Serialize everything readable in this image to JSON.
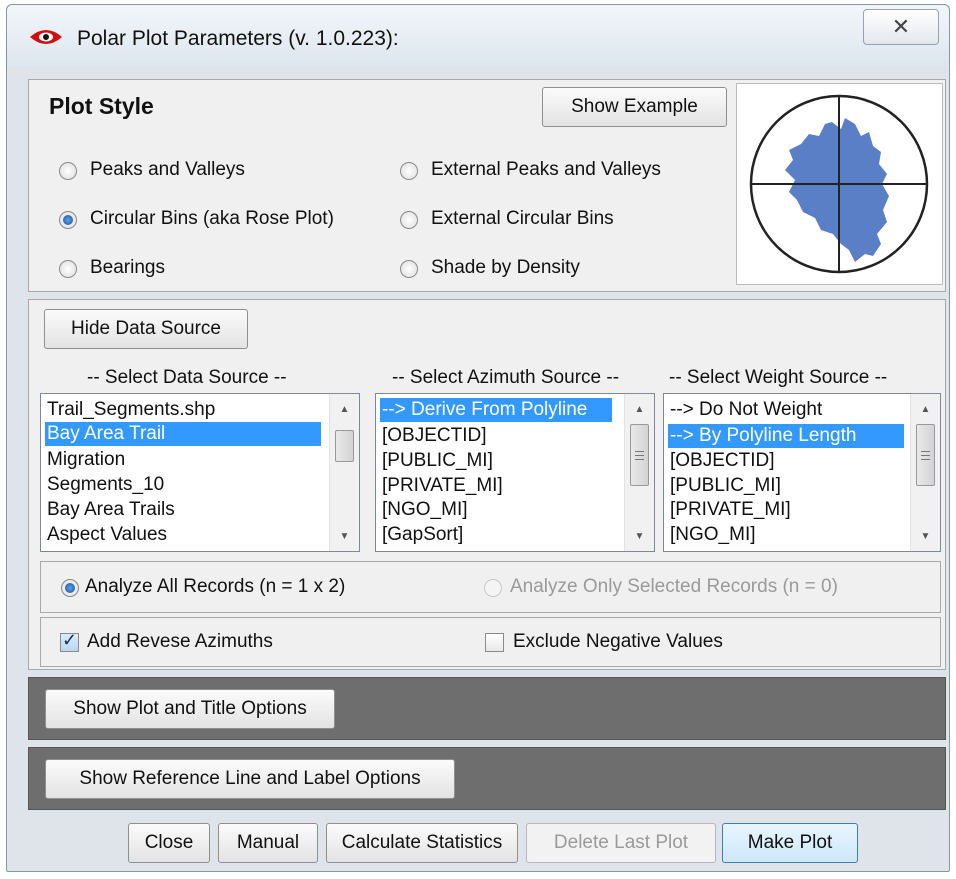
{
  "window": {
    "title": "Polar Plot Parameters (v. 1.0.223):",
    "close_glyph": "✕"
  },
  "plot_style": {
    "heading": "Plot Style",
    "show_example_label": "Show Example",
    "options": [
      {
        "label": "Peaks and Valleys",
        "checked": false
      },
      {
        "label": "External Peaks and Valleys",
        "checked": false
      },
      {
        "label": "Circular Bins (aka Rose Plot)",
        "checked": true
      },
      {
        "label": "External Circular Bins",
        "checked": false
      },
      {
        "label": "Bearings",
        "checked": false
      },
      {
        "label": "Shade by Density",
        "checked": false
      }
    ],
    "preview_icon": "rose-plot-preview",
    "preview_fill": "#5b7fc6"
  },
  "data_source": {
    "hide_button_label": "Hide Data Source",
    "data_list": {
      "caption": "-- Select Data Source --",
      "items": [
        "Trail_Segments.shp",
        "Bay Area Trail",
        "Migration",
        "Segments_10",
        "Bay Area Trails",
        "Aspect Values"
      ],
      "selected": "Bay Area Trail"
    },
    "azimuth_list": {
      "caption": "-- Select Azimuth Source --",
      "items": [
        "--> Derive From Polyline",
        "[OBJECTID]",
        "[PUBLIC_MI]",
        "[PRIVATE_MI]",
        "[NGO_MI]",
        "[GapSort]"
      ],
      "selected": "--> Derive From Polyline"
    },
    "weight_list": {
      "caption": "-- Select Weight Source --",
      "items": [
        "--> Do Not Weight",
        "--> By Polyline Length",
        "[OBJECTID]",
        "[PUBLIC_MI]",
        "[PRIVATE_MI]",
        "[NGO_MI]"
      ],
      "selected": "--> By Polyline Length"
    },
    "analyze_all_label": "Analyze All Records (n = 1 x 2)",
    "analyze_selected_label": "Analyze Only Selected Records (n = 0)",
    "reverse_label": "Add Revese Azimuths",
    "reverse_checked": true,
    "exclude_label": "Exclude Negative Values",
    "exclude_checked": false
  },
  "sections": {
    "plot_title_label": "Show Plot and Title Options",
    "reference_label": "Show Reference Line and Label Options"
  },
  "footer": {
    "close_label": "Close",
    "manual_label": "Manual",
    "stats_label": "Calculate Statistics",
    "delete_label": "Delete Last Plot",
    "make_label": "Make Plot"
  },
  "colors": {
    "selection": "#3399ff",
    "dark_section": "#6e6e6e",
    "primary_border": "#3c7fb1"
  }
}
